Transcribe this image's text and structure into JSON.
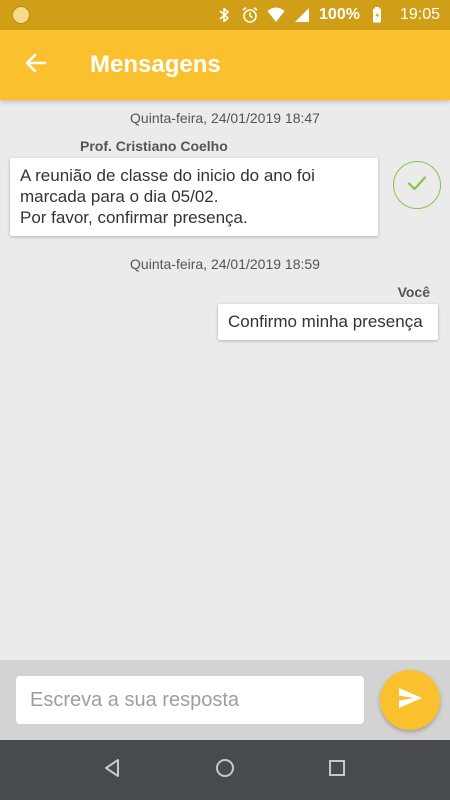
{
  "status_bar": {
    "battery_text": "100%",
    "time": "19:05",
    "icons": [
      "notification-icon",
      "bluetooth-icon",
      "alarm-icon",
      "wifi-icon",
      "signal-icon",
      "battery-charging-icon"
    ]
  },
  "app_bar": {
    "title": "Mensagens",
    "back_icon": "arrow-left-icon"
  },
  "messages": [
    {
      "timestamp": "Quinta-feira, 24/01/2019 18:47",
      "sender": "Prof. Cristiano Coelho",
      "lines": [
        "A reunião de classe do inicio do ano foi",
        "marcada para o dia 05/02.",
        "Por favor, confirmar presença."
      ],
      "action_icon": "checkmark-icon"
    },
    {
      "timestamp": "Quinta-feira, 24/01/2019 18:59",
      "sender": "Você",
      "lines": [
        "Confirmo minha presença"
      ]
    }
  ],
  "reply": {
    "placeholder": "Escreva a sua resposta",
    "value": "",
    "send_icon": "send-icon"
  },
  "nav_bar": {
    "icons": [
      "back-triangle-icon",
      "home-circle-icon",
      "recents-square-icon"
    ]
  },
  "colors": {
    "status_bar": "#d19f17",
    "app_bar": "#fbc02d",
    "accent_check": "#8bc34a",
    "background": "#ebebeb",
    "input_bar": "#d3d3d3",
    "nav_bar": "#474b50"
  }
}
